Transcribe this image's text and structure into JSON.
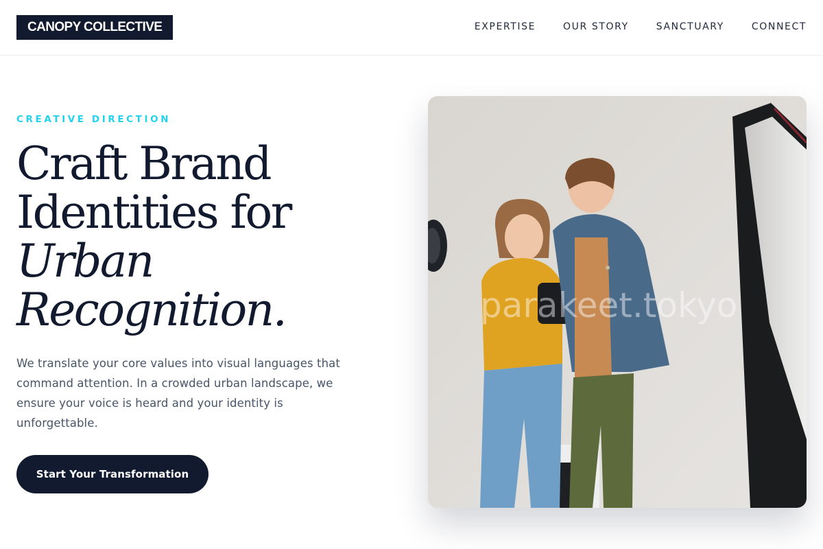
{
  "header": {
    "logo_text": "CANOPY COLLECTIVE",
    "nav": [
      {
        "label": "EXPERTISE"
      },
      {
        "label": "OUR STORY"
      },
      {
        "label": "SANCTUARY"
      },
      {
        "label": "CONNECT"
      }
    ]
  },
  "hero": {
    "eyebrow": "CREATIVE DIRECTION",
    "headline": {
      "line1": "Craft Brand",
      "line2": "Identities for",
      "line3_italic": "Urban",
      "line4_italic": "Recognition."
    },
    "description": "We translate your core values into visual languages that command attention. In a crowded urban landscape, we ensure your voice is heard and your identity is unforgettable.",
    "cta_label": "Start Your Transformation",
    "image": {
      "watermark": "parakeet.tokyo"
    }
  },
  "colors": {
    "brand_dark": "#111a2e",
    "accent_cyan": "#22d3ee",
    "body_text": "#475569"
  }
}
